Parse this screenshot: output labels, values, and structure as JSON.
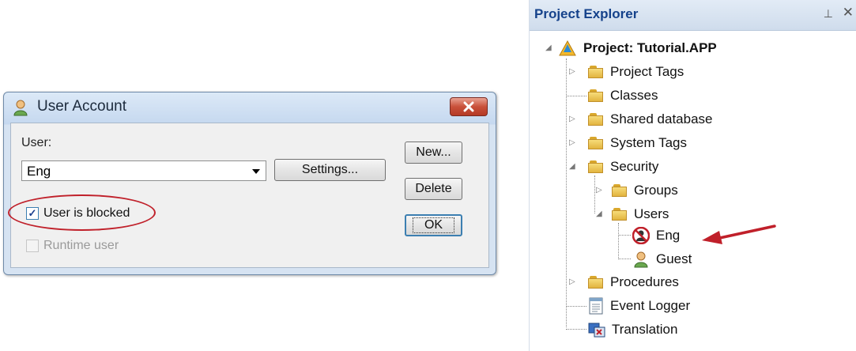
{
  "dialog": {
    "title": "User Account",
    "user_label": "User:",
    "user_value": "Eng",
    "settings_button": "Settings...",
    "new_button": "New...",
    "delete_button": "Delete",
    "ok_button": "OK",
    "blocked_label": "User is blocked",
    "blocked_checked": true,
    "runtime_label": "Runtime user",
    "runtime_checked": false,
    "runtime_disabled": true
  },
  "explorer": {
    "title": "Project Explorer",
    "pin_icon": "pin-icon",
    "close_icon": "close-icon",
    "tree": [
      {
        "label": "Project: Tutorial.APP",
        "icon": "project-icon",
        "level": 0,
        "expanded": true
      },
      {
        "label": "Project Tags",
        "icon": "folder-icon",
        "level": 1,
        "expanded": false
      },
      {
        "label": "Classes",
        "icon": "folder-icon",
        "level": 1
      },
      {
        "label": "Shared database",
        "icon": "folder-icon",
        "level": 1,
        "expanded": false
      },
      {
        "label": "System Tags",
        "icon": "folder-icon",
        "level": 1,
        "expanded": false
      },
      {
        "label": "Security",
        "icon": "folder-icon",
        "level": 1,
        "expanded": true
      },
      {
        "label": "Groups",
        "icon": "folder-icon",
        "level": 2,
        "expanded": false
      },
      {
        "label": "Users",
        "icon": "folder-icon",
        "level": 2,
        "expanded": true
      },
      {
        "label": "Eng",
        "icon": "blocked-user-icon",
        "level": 3
      },
      {
        "label": "Guest",
        "icon": "user-icon",
        "level": 3
      },
      {
        "label": "Procedures",
        "icon": "folder-icon",
        "level": 1,
        "expanded": false
      },
      {
        "label": "Event Logger",
        "icon": "event-logger-icon",
        "level": 1
      },
      {
        "label": "Translation",
        "icon": "translation-icon",
        "level": 1
      }
    ]
  },
  "colors": {
    "highlight": "#c0202a",
    "arrow": "#c0202a",
    "explorer_title": "#15428b"
  }
}
